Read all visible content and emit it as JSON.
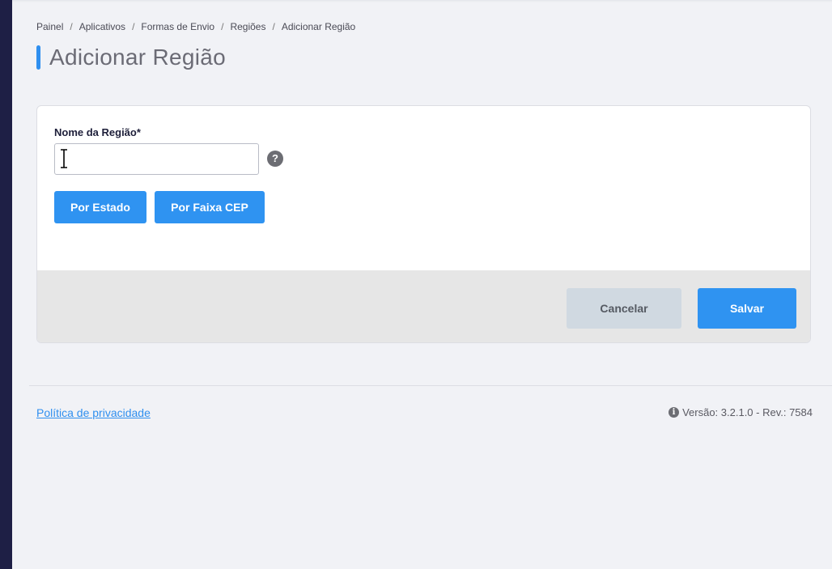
{
  "breadcrumb": {
    "items": [
      "Painel",
      "Aplicativos",
      "Formas de Envio",
      "Regiões",
      "Adicionar Região"
    ],
    "separator": "/"
  },
  "page": {
    "title": "Adicionar Região"
  },
  "form": {
    "region_name_label": "Nome da Região*",
    "region_name_value": "",
    "help_icon": "?",
    "by_state_label": "Por Estado",
    "by_cep_range_label": "Por Faixa CEP"
  },
  "actions": {
    "cancel_label": "Cancelar",
    "save_label": "Salvar"
  },
  "footer": {
    "privacy_label": "Política de privacidade",
    "version_text": "Versão: 3.2.1.0 - Rev.: 7584",
    "info_icon": "i"
  },
  "colors": {
    "accent": "#2f93f1",
    "sidebar": "#1e1f45",
    "background": "#f1f2f6",
    "cancel_button": "#d0d9e1"
  }
}
